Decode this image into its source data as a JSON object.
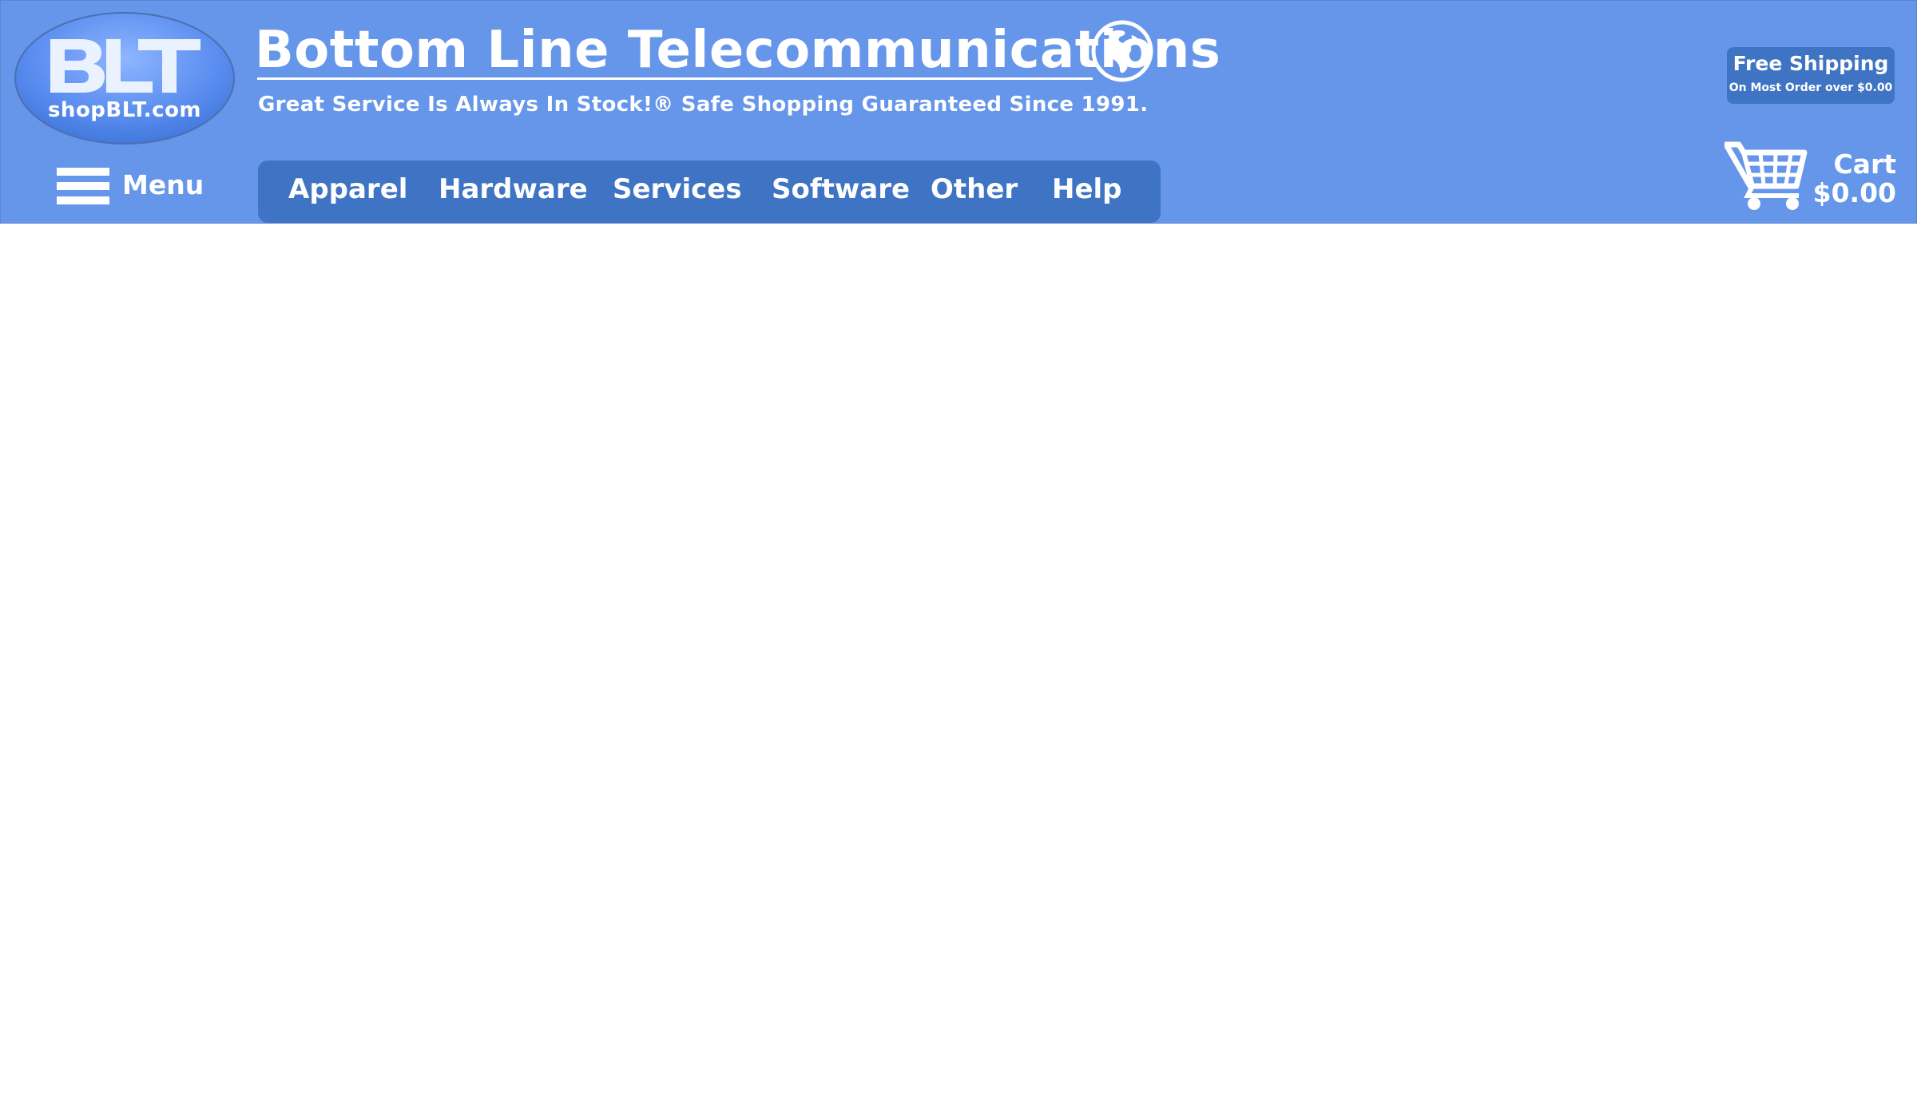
{
  "logo": {
    "letters": "BLT",
    "site": "shopBLT.com"
  },
  "header": {
    "title": "Bottom Line Telecommunications",
    "tagline": "Great Service Is Always In Stock!® Safe Shopping Guaranteed Since 1991."
  },
  "menu": {
    "label": "Menu",
    "icon": "hamburger-icon"
  },
  "nav": {
    "items": [
      {
        "label": "Apparel"
      },
      {
        "label": "Hardware"
      },
      {
        "label": "Services"
      },
      {
        "label": "Software"
      },
      {
        "label": "Other"
      },
      {
        "label": "Help"
      }
    ]
  },
  "shipping": {
    "title": "Free Shipping",
    "subtitle": "On Most Order over $0.00"
  },
  "cart": {
    "label": "Cart",
    "total": "$0.00",
    "icon": "shopping-cart-icon"
  },
  "colors": {
    "header_bg": "#6596ea",
    "nav_bg": "#3f74c4",
    "text": "#ffffff"
  }
}
